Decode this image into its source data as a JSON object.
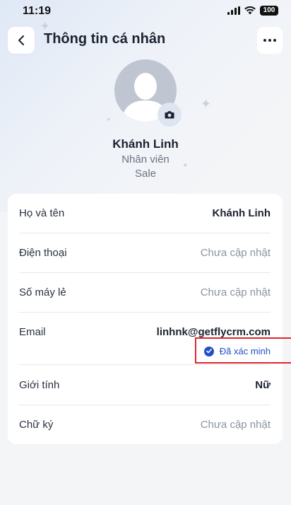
{
  "status_bar": {
    "time": "11:19",
    "battery": "100"
  },
  "header": {
    "title": "Thông tin cá nhân"
  },
  "profile": {
    "name": "Khánh Linh",
    "role": "Nhân viên",
    "department": "Sale"
  },
  "info": [
    {
      "label": "Họ và tên",
      "value": "Khánh Linh",
      "style": "strong"
    },
    {
      "label": "Điện thoại",
      "value": "Chưa cập nhật",
      "style": "muted"
    },
    {
      "label": "Số máy lẻ",
      "value": "Chưa cập nhật",
      "style": "muted"
    },
    {
      "label": "Email",
      "value": "linhnk@getflycrm.com",
      "style": "strong",
      "badge": "Đã xác minh"
    },
    {
      "label": "Giới tính",
      "value": "Nữ",
      "style": "strong"
    },
    {
      "label": "Chữ ký",
      "value": "Chưa cập nhật",
      "style": "muted"
    }
  ],
  "colors": {
    "accent": "#1f4fc9",
    "highlight": "#e0262b",
    "muted_text": "#8a93a3"
  }
}
